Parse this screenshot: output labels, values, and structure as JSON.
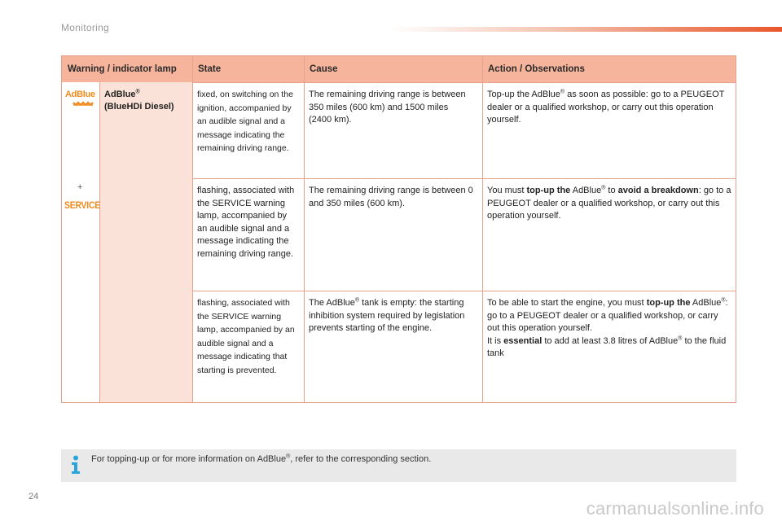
{
  "page": {
    "section_title": "Monitoring",
    "page_number": "24",
    "watermark": "carmanualsonline.info"
  },
  "table": {
    "headers": [
      "Warning / indicator lamp",
      "State",
      "Cause",
      "Action / Observations"
    ],
    "lamp_label_line1": "AdBlue",
    "lamp_label_reg": "®",
    "lamp_label_line2": "(BlueHDi Diesel)",
    "icon_adblue_text": "AdBlue",
    "icon_plus": "+",
    "icon_service_text": "SERVICE",
    "rows": [
      {
        "state": "fixed, on switching on the ignition, accompanied by an audible signal and a message indicating the remaining driving range.",
        "cause": "The remaining driving range is between 350 miles (600 km) and 1500 miles (2400 km).",
        "action_a": "Top-up the AdBlue",
        "action_b": " as soon as possible: go to a PEUGEOT dealer or a qualified workshop, or carry out this operation yourself."
      },
      {
        "state": "flashing, associated with the SERVICE warning lamp, accompanied by an audible signal and a message indicating the remaining driving range.",
        "cause": "The remaining driving range is between 0 and 350 miles (600 km).",
        "action_a": "You must ",
        "action_b": "top-up the",
        "action_c": " AdBlue",
        "action_d": " to ",
        "action_e": "avoid a breakdown",
        "action_f": ": go to a PEUGEOT dealer or a qualified workshop, or carry out this operation yourself."
      },
      {
        "state": "flashing, associated with the SERVICE warning lamp, accompanied by an audible signal and a message indicating that starting is prevented.",
        "cause_a": "The AdBlue",
        "cause_b": " tank is empty: the starting inhibition system required by legislation prevents starting of the engine.",
        "action_a": "To be able to start the engine, you must ",
        "action_b": "top-up the",
        "action_c": " AdBlue",
        "action_d": ": go to a PEUGEOT dealer or a qualified workshop, or carry out this operation yourself.",
        "action_e": "It is ",
        "action_f": "essential",
        "action_g": " to add at least 3.8 litres of AdBlue",
        "action_h": " to the fluid tank"
      }
    ],
    "reg_mark": "®"
  },
  "info": {
    "text_a": "For topping-up or for more information on AdBlue",
    "text_b": ", refer to the corresponding section."
  },
  "colors": {
    "header_bg": "#f6b49c",
    "label_col_bg": "#fbe2d8",
    "border": "#e8a18a",
    "accent_orange": "#f08a1e",
    "info_blue": "#2aa4dd"
  }
}
